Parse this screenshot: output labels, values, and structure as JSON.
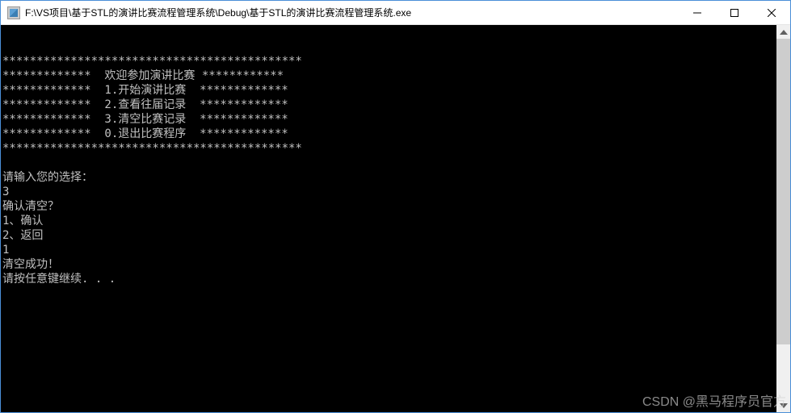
{
  "titlebar": {
    "path": "F:\\VS项目\\基于STL的演讲比赛流程管理系统\\Debug\\基于STL的演讲比赛流程管理系统.exe"
  },
  "console": {
    "lines": [
      "********************************************",
      "*************  欢迎参加演讲比赛 ************",
      "*************  1.开始演讲比赛  *************",
      "*************  2.查看往届记录  *************",
      "*************  3.清空比赛记录  *************",
      "*************  0.退出比赛程序  *************",
      "********************************************",
      "",
      "请输入您的选择：",
      "3",
      "确认清空？",
      "1、确认",
      "2、返回",
      "1",
      "清空成功！",
      "请按任意键继续. . ."
    ]
  },
  "watermark": "CSDN @黑马程序员官方"
}
